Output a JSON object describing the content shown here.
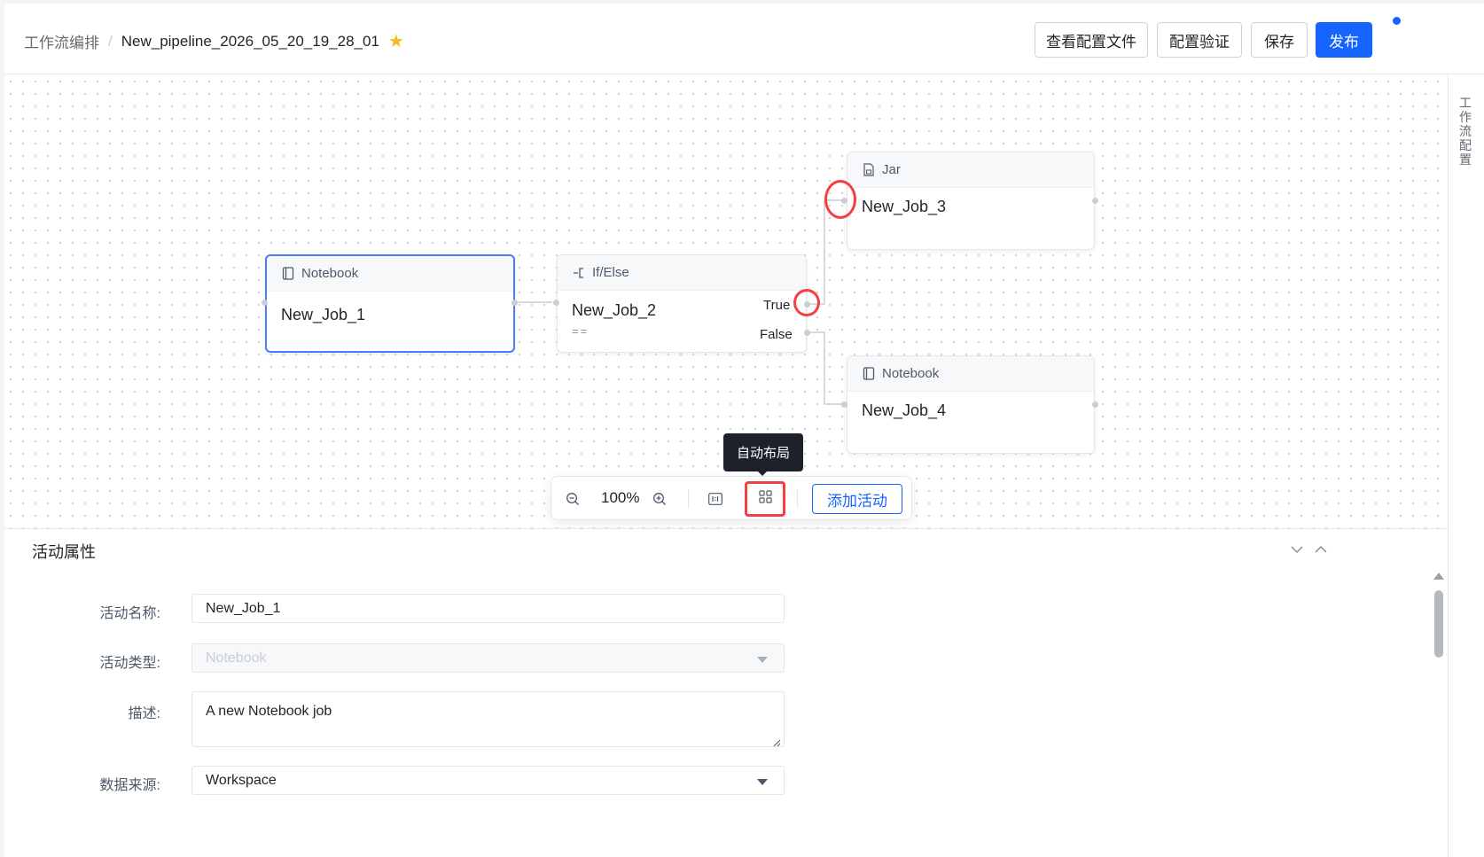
{
  "header": {
    "breadcrumb_parent": "工作流编排",
    "breadcrumb_separator": "/",
    "pipeline_name": "New_pipeline_2026_05_20_19_28_01",
    "favorite_icon": "star-icon",
    "buttons": {
      "view_config": "查看配置文件",
      "validate_config": "配置验证",
      "save": "保存",
      "publish": "发布"
    }
  },
  "right_sidebar": {
    "label": "工作流配置"
  },
  "canvas": {
    "nodes": {
      "job1": {
        "type": "Notebook",
        "name": "New_Job_1",
        "selected": true
      },
      "job2": {
        "type": "If/Else",
        "name": "New_Job_2",
        "condition": "==",
        "true_label": "True",
        "false_label": "False"
      },
      "job3": {
        "type": "Jar",
        "name": "New_Job_3"
      },
      "job4": {
        "type": "Notebook",
        "name": "New_Job_4"
      }
    },
    "toolbar": {
      "zoom_level": "100%",
      "tooltip": "自动布局",
      "add_activity": "添加活动"
    }
  },
  "properties": {
    "title": "活动属性",
    "fields": {
      "name_label": "活动名称:",
      "name_value": "New_Job_1",
      "type_label": "活动类型:",
      "type_value": "Notebook",
      "desc_label": "描述:",
      "desc_value": "A new Notebook job",
      "source_label": "数据来源:",
      "source_value": "Workspace"
    }
  },
  "colors": {
    "primary": "#1664ff",
    "highlight": "#f53f3f",
    "favorite": "#f7ba1e",
    "selected_border": "#4080ff"
  }
}
